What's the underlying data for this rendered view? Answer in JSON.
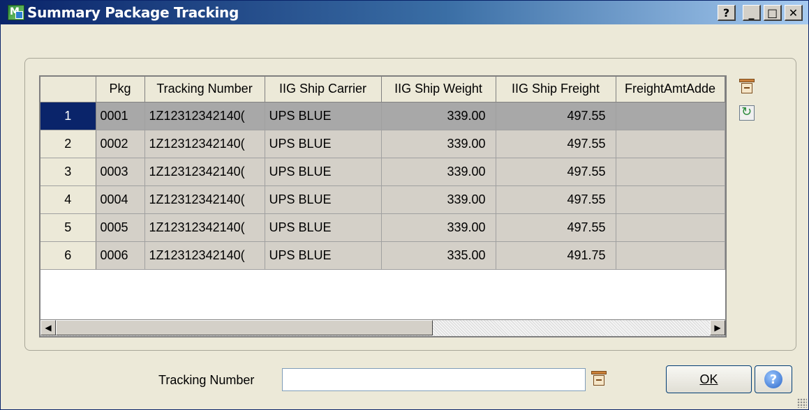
{
  "window": {
    "title": "Summary Package Tracking",
    "buttons": {
      "help": "?",
      "minimize": "_",
      "maximize": "□",
      "close": "✕"
    }
  },
  "grid": {
    "columns": [
      "",
      "Pkg",
      "Tracking Number",
      "IIG Ship Carrier",
      "IIG Ship Weight",
      "IIG Ship Freight",
      "FreightAmtAdde"
    ],
    "rows": [
      {
        "num": "1",
        "pkg": "0001",
        "tracking": "1Z12312342140(",
        "carrier": "UPS BLUE",
        "weight": "339.00",
        "freight": "497.55",
        "freight_added": ""
      },
      {
        "num": "2",
        "pkg": "0002",
        "tracking": "1Z12312342140(",
        "carrier": "UPS BLUE",
        "weight": "339.00",
        "freight": "497.55",
        "freight_added": ""
      },
      {
        "num": "3",
        "pkg": "0003",
        "tracking": "1Z12312342140(",
        "carrier": "UPS BLUE",
        "weight": "339.00",
        "freight": "497.55",
        "freight_added": ""
      },
      {
        "num": "4",
        "pkg": "0004",
        "tracking": "1Z12312342140(",
        "carrier": "UPS BLUE",
        "weight": "339.00",
        "freight": "497.55",
        "freight_added": ""
      },
      {
        "num": "5",
        "pkg": "0005",
        "tracking": "1Z12312342140(",
        "carrier": "UPS BLUE",
        "weight": "339.00",
        "freight": "497.55",
        "freight_added": ""
      },
      {
        "num": "6",
        "pkg": "0006",
        "tracking": "1Z12312342140(",
        "carrier": "UPS BLUE",
        "weight": "335.00",
        "freight": "491.75",
        "freight_added": ""
      }
    ],
    "scroll": {
      "left": "◀",
      "right": "▶"
    }
  },
  "footer": {
    "tracking_label": "Tracking Number",
    "tracking_value": "",
    "ok_label": "OK",
    "help": "?"
  },
  "icons": [
    "lookup-icon",
    "sync-icon",
    "app-icon",
    "help-icon"
  ]
}
